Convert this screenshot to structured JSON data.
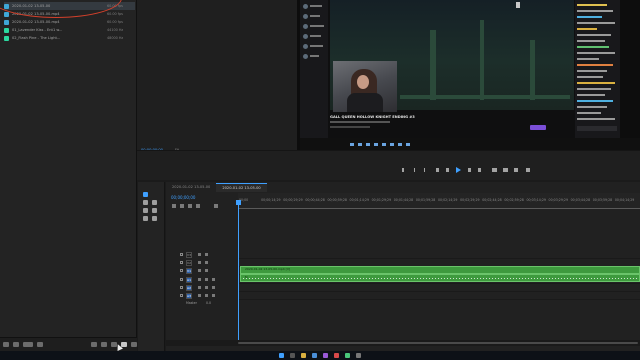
{
  "project": {
    "items": [
      {
        "icon": "sequence-icon",
        "name": "2020-01-02 13-05-00",
        "rate": "60.00 fps",
        "selected": true
      },
      {
        "icon": "clip-icon",
        "name": "2020-01-02 13-05-00.mp4",
        "rate": "60.00 fps",
        "selected": false
      },
      {
        "icon": "clip-icon",
        "name": "2020-01-02 13-05-00.mp4",
        "rate": "60.00 fps",
        "selected": false
      },
      {
        "icon": "clip-icon",
        "name": "01_Lavender Kiss - Ent1 w...",
        "rate": "44100 Hz",
        "selected": false
      },
      {
        "icon": "clip-icon",
        "name": "02_Flash Pine - The Light...",
        "rate": "48000 Hz",
        "selected": false
      }
    ]
  },
  "source": {
    "timecode": "00;00;00;00",
    "fit": "Fit"
  },
  "program": {
    "stream_title": "GALL QUEEN HOLLOW KNIGHT ENDING #3",
    "follow_label": "Follow"
  },
  "timeline": {
    "tabs": [
      "2020-01-02 13-05-00",
      "2020-01-02 13-05-00"
    ],
    "timecode": "00;00;00;00",
    "ruler": [
      "00;00",
      "00;00;14;29",
      "00;00;29;29",
      "00;00;44;28",
      "00;00;59;28",
      "00;01;14;29",
      "00;01;29;29",
      "00;01;44;28",
      "00;01;59;28",
      "00;02;14;29",
      "00;02;29;29",
      "00;02;44;28",
      "00;02;59;28",
      "00;03;14;29",
      "00;03;29;29",
      "00;03;44;28",
      "00;03;59;28",
      "00;04;14;29"
    ],
    "tracks": [
      {
        "name": "V3",
        "target": false
      },
      {
        "name": "V2",
        "target": false
      },
      {
        "name": "V1",
        "target": true
      },
      {
        "name": "A1",
        "target": true
      },
      {
        "name": "A2",
        "target": true
      },
      {
        "name": "A3",
        "target": true
      }
    ],
    "master_label": "Master",
    "master_value": "0.0",
    "video_clip_label": "2020-01-02 13-05-00.mp4 [V]",
    "audio_clip_label": "fx"
  },
  "colors": {
    "accent": "#3fa0ff",
    "clip_green": "#3e9a3e",
    "annotation_red": "#d2402b",
    "clip_icon": "#2bd9a0"
  }
}
